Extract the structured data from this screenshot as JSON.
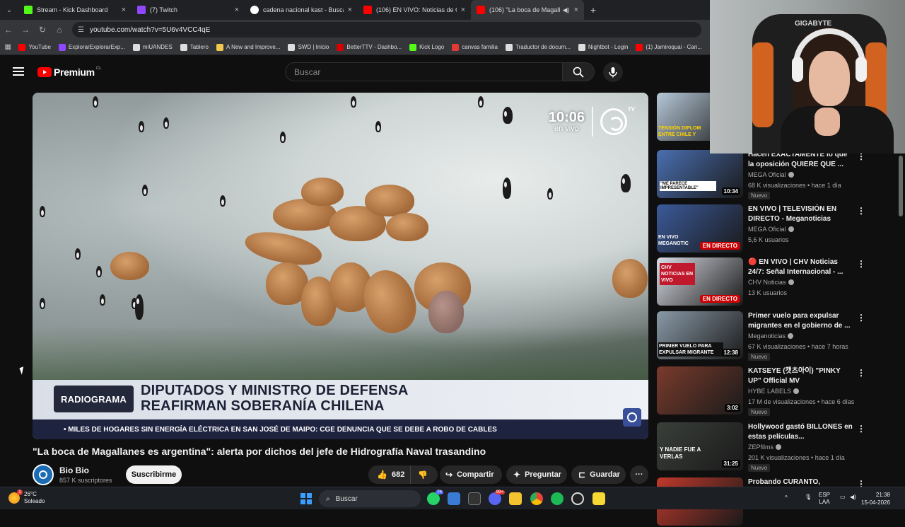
{
  "tabs": [
    {
      "title": "Stream - Kick Dashboard",
      "color": "#53fc18",
      "active": false
    },
    {
      "title": "(7) Twitch",
      "color": "#9146ff",
      "active": false
    },
    {
      "title": "cadena nacional kast - Buscar c",
      "color": "#ffffff",
      "active": false
    },
    {
      "title": "(106) EN VIVO: Noticias de Chil",
      "color": "#ff0000",
      "active": false
    },
    {
      "title": "(106) \"La boca de Magallan",
      "color": "#ff0000",
      "active": true
    }
  ],
  "address": {
    "url": "youtube.com/watch?v=5U6v4VCC4qE"
  },
  "bookmarks": [
    {
      "label": "YouTube",
      "color": "#ff0000"
    },
    {
      "label": "ExplorarExplorarExp...",
      "color": "#9146ff"
    },
    {
      "label": "miUANDES",
      "color": "#dddddd"
    },
    {
      "label": "Tablero",
      "color": "#dddddd"
    },
    {
      "label": "A New and Improve...",
      "color": "#f2c94c"
    },
    {
      "label": "SWD | Inicio",
      "color": "#dddddd"
    },
    {
      "label": "BetterTTV - Dashbo...",
      "color": "#d50000"
    },
    {
      "label": "Kick Logo",
      "color": "#53fc18"
    },
    {
      "label": "canvas familia",
      "color": "#e53935"
    },
    {
      "label": "Traductor de docum...",
      "color": "#dddddd"
    },
    {
      "label": "Nightbot - Login",
      "color": "#dddddd"
    },
    {
      "label": "(1) Jamiroquai - Can...",
      "color": "#ff0000"
    }
  ],
  "youtube": {
    "logo_text": "Premium",
    "country": "CL",
    "search_placeholder": "Buscar"
  },
  "player": {
    "clock": "10:06",
    "live_label": "en vivo",
    "network_tag": "TV",
    "segment": "RADIOGRAMA",
    "headline_line1": "DIPUTADOS Y MINISTRO DE DEFENSA",
    "headline_line2": "REAFIRMAN SOBERANÍA CHILENA",
    "ticker": "• MILES DE HOGARES SIN ENERGÍA ELÉCTRICA EN SAN JOSÉ DE MAIPO: CGE DENUNCIA QUE SE DEBE A ROBO DE CABLES"
  },
  "video": {
    "title": "\"La boca de Magallanes es argentina\": alerta por dichos del jefe de Hidrografía Naval trasandino",
    "channel": "Bio Bio",
    "subscribers": "857 K suscriptores",
    "subscribe_label": "Suscribirme",
    "likes": "682",
    "share_label": "Compartir",
    "ask_label": "Preguntar",
    "save_label": "Guardar"
  },
  "recommendations": [
    {
      "title": "TENSIÓN DIPLOMÁTICA ENTRE CHILE Y ...",
      "channel": "",
      "meta": "",
      "badge": "",
      "duration": "",
      "thumb": "#b6c8d8"
    },
    {
      "title": "Hacen EXACTAMENTE lo que la oposición QUIERE QUE ...",
      "channel": "MEGA Oficial",
      "meta": "68 K visualizaciones • hace 1 día",
      "badge": "Nuevo",
      "duration": "10:34",
      "thumb": "#4a6fb1"
    },
    {
      "title": "EN VIVO | TELEVISIÓN EN DIRECTO - Meganoticias Prim...",
      "channel": "MEGA Oficial",
      "meta": "5,6 K usuarios",
      "badge": "",
      "duration": "EN DIRECTO",
      "thumb": "#3b5a9a"
    },
    {
      "title": "🔴 EN VIVO | CHV Noticias 24/7: Señal Internacional - ...",
      "channel": "CHV Noticias",
      "meta": "13 K usuarios",
      "badge": "",
      "duration": "EN DIRECTO",
      "thumb": "#d9dde6"
    },
    {
      "title": "Primer vuelo para expulsar migrantes en el gobierno de ...",
      "channel": "Meganoticias",
      "meta": "67 K visualizaciones • hace 7 horas",
      "badge": "Nuevo",
      "duration": "12:38",
      "thumb": "#8a9aa8"
    },
    {
      "title": "KATSEYE (캣츠아이) \"PINKY UP\" Official MV",
      "channel": "HYBE LABELS",
      "meta": "17 M de visualizaciones • hace 6 días",
      "badge": "Nuevo",
      "duration": "3:02",
      "thumb": "#7a3b2c"
    },
    {
      "title": "Hollywood gastó BILLONES en estas películas...",
      "channel": "ZEPfilms",
      "meta": "201 K visualizaciones • hace 1 día",
      "badge": "Nuevo",
      "duration": "31:25",
      "thumb": "#3a3f3a"
    },
    {
      "title": "Probando CURANTO,",
      "channel": "",
      "meta": "",
      "badge": "",
      "duration": "",
      "thumb": "#c0392b"
    }
  ],
  "rec_thumb_labels": [
    "TENSIÓN DIPLOM",
    "ENTRE CHILE Y",
    "\"ME PARECE IMPRESENTABLE\"",
    "EN VIVO MEGANOTIC",
    "CHV NOTICIAS EN VIVO",
    "PRIMER VUELO PARA EXPULSAR MIGRANTE",
    "Y NADIE FUE A VERLAS"
  ],
  "webcam": {
    "brand": "GIGABYTE"
  },
  "taskbar": {
    "temperature": "26°C",
    "condition": "Soleado",
    "search": "Buscar",
    "badge1": "74",
    "badge2": "99+",
    "lang1": "ESP",
    "lang2": "LAA",
    "time": "21:38",
    "date": "15-04-2026"
  }
}
